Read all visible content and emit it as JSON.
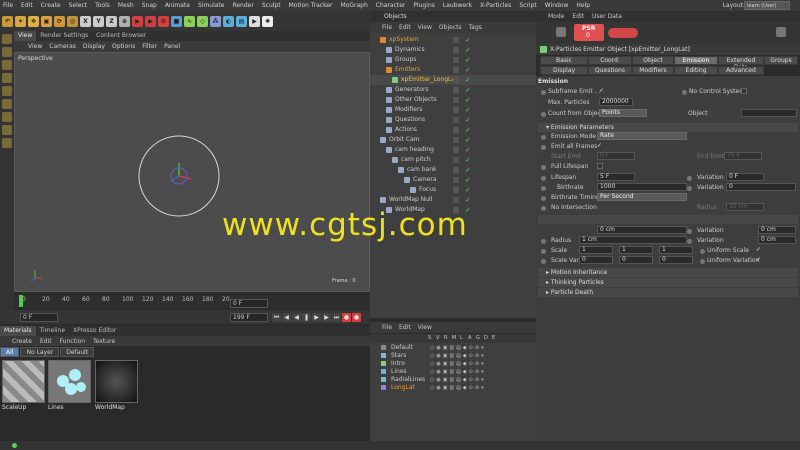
{
  "menubar": {
    "items": [
      "File",
      "Edit",
      "Create",
      "Select",
      "Tools",
      "Mesh",
      "Snap",
      "Animate",
      "Simulate",
      "Render",
      "Sculpt",
      "Motion Tracker",
      "MoGraph",
      "Character",
      "Plugins",
      "Laubwerk",
      "X-Particles",
      "Script",
      "Window",
      "Help"
    ],
    "layout_label": "Layout:",
    "layout_value": "learn (User)"
  },
  "toolbar": {
    "axis_x": "X",
    "axis_y": "Y",
    "axis_z": "Z"
  },
  "viewport": {
    "tabs": [
      "View",
      "Render Settings",
      "Content Browser"
    ],
    "menu": [
      "View",
      "Cameras",
      "Display",
      "Options",
      "Filter",
      "Panel"
    ],
    "label": "Perspective",
    "frame_label": "Frame : 0"
  },
  "timeline": {
    "ticks": [
      "0",
      "20",
      "40",
      "60",
      "80",
      "100",
      "120",
      "140",
      "160",
      "180",
      "20"
    ],
    "frame_field": "0 F",
    "start_field": "0 F",
    "end_field": "199 F"
  },
  "materials": {
    "tabs": [
      "Materials",
      "Timeline",
      "XPresso Editor"
    ],
    "menu": [
      "Create",
      "Edit",
      "Function",
      "Texture"
    ],
    "filters": [
      "All",
      "No Layer",
      "Default"
    ],
    "items": [
      "ScaleUp",
      "Lines",
      "WorldMap"
    ]
  },
  "objects": {
    "tab": "Objects",
    "menu": [
      "File",
      "Edit",
      "View",
      "Objects",
      "Tags"
    ],
    "rows": [
      {
        "name": "xpSystem",
        "indent": 0,
        "color": "#f0a030"
      },
      {
        "name": "Dynamics",
        "indent": 1,
        "color": "#cccccc"
      },
      {
        "name": "Groups",
        "indent": 1,
        "color": "#cccccc"
      },
      {
        "name": "Emitters",
        "indent": 1,
        "color": "#f0a030"
      },
      {
        "name": "xpEmitter_LongLat",
        "indent": 2,
        "color": "#f0c040"
      },
      {
        "name": "Generators",
        "indent": 1,
        "color": "#cccccc"
      },
      {
        "name": "Other Objects",
        "indent": 1,
        "color": "#cccccc"
      },
      {
        "name": "Modifiers",
        "indent": 1,
        "color": "#cccccc"
      },
      {
        "name": "Questions",
        "indent": 1,
        "color": "#cccccc"
      },
      {
        "name": "Actions",
        "indent": 1,
        "color": "#cccccc"
      },
      {
        "name": "Orbit Cam",
        "indent": 0,
        "color": "#cccccc"
      },
      {
        "name": "cam heading",
        "indent": 1,
        "color": "#cccccc"
      },
      {
        "name": "cam pitch",
        "indent": 2,
        "color": "#cccccc"
      },
      {
        "name": "cam bank",
        "indent": 3,
        "color": "#cccccc"
      },
      {
        "name": "Camera",
        "indent": 4,
        "color": "#cccccc"
      },
      {
        "name": "Focus",
        "indent": 5,
        "color": "#cccccc"
      },
      {
        "name": "WorldMap Null",
        "indent": 0,
        "color": "#cccccc"
      },
      {
        "name": "WorldMap",
        "indent": 1,
        "color": "#cccccc"
      }
    ]
  },
  "layers": {
    "menu": [
      "File",
      "Edit",
      "View"
    ],
    "header": [
      "S",
      "V",
      "R",
      "M",
      "L",
      "A",
      "G",
      "D",
      "E"
    ],
    "rows": [
      {
        "name": "Default",
        "color": "#888888"
      },
      {
        "name": "Stars",
        "color": "#8bb0d8"
      },
      {
        "name": "Intro",
        "color": "#7fd07f"
      },
      {
        "name": "Lines",
        "color": "#6fb0e0"
      },
      {
        "name": "RadialLines",
        "color": "#6fc0c0"
      },
      {
        "name": "LongLat",
        "color": "#9a7fe0"
      }
    ]
  },
  "attributes": {
    "tabs": [
      "Mode",
      "Edit",
      "User Data"
    ],
    "psr_label": "PSR",
    "psr_value": "0",
    "title": "X-Particles Emitter Object [xpEmitter_LongLat]",
    "tab_grid": [
      [
        "Basic",
        "Coord.",
        "Object",
        "Emission",
        "Extended Data",
        "Groups"
      ],
      [
        "Display",
        "Questions",
        "Modifiers",
        "Editing",
        "Advanced"
      ]
    ],
    "active_tab": "Emission",
    "emission": {
      "section": "Emission",
      "subframe_label": "Subframe Emit . . .",
      "no_control_label": "No Control System",
      "max_particles_label": "Max. Particles",
      "max_particles_value": "2000000",
      "count_from_label": "Count from Object",
      "count_from_value": "Points",
      "object_label": "Object"
    },
    "params": {
      "section": "Emission Parameters",
      "mode_label": "Emission Mode",
      "mode_value": "Rate",
      "emit_all_label": "Emit all Frames",
      "start_emit_label": "Start Emit",
      "start_emit_value": "0 F",
      "end_emit_label": "End Emit",
      "end_emit_value": "75 F",
      "full_lifespan_label": "Full Lifespan",
      "lifespan_label": "Lifespan",
      "lifespan_value": "5 F",
      "variation_label": "Variation",
      "lifespan_var_value": "0 F",
      "birthrate_label": "Birthrate",
      "birthrate_value": "1000",
      "birthrate_var_value": "0",
      "timing_label": "Birthrate Timing",
      "timing_value": "Per Second",
      "no_intersection_label": "No Intersection",
      "radius_label": "Radius",
      "radius_value": "10 cm"
    },
    "particle": {
      "speed_value": "0 cm",
      "speed_var_value": "0 cm",
      "radius_label": "Radius",
      "radius_value": "1 cm",
      "radius_var_value": "0 cm",
      "scale_label": "Scale",
      "scale_values": [
        "1",
        "1",
        "1"
      ],
      "uniform_scale_label": "Uniform Scale",
      "scale_var_label": "Scale Var.",
      "scale_var_values": [
        "0",
        "0",
        "0"
      ],
      "uniform_var_label": "Uniform Variation"
    },
    "collapsed_sections": [
      "Motion Inheritance",
      "Thinking Particles",
      "Particle Death"
    ]
  },
  "watermark": "www.cgtsj.com"
}
